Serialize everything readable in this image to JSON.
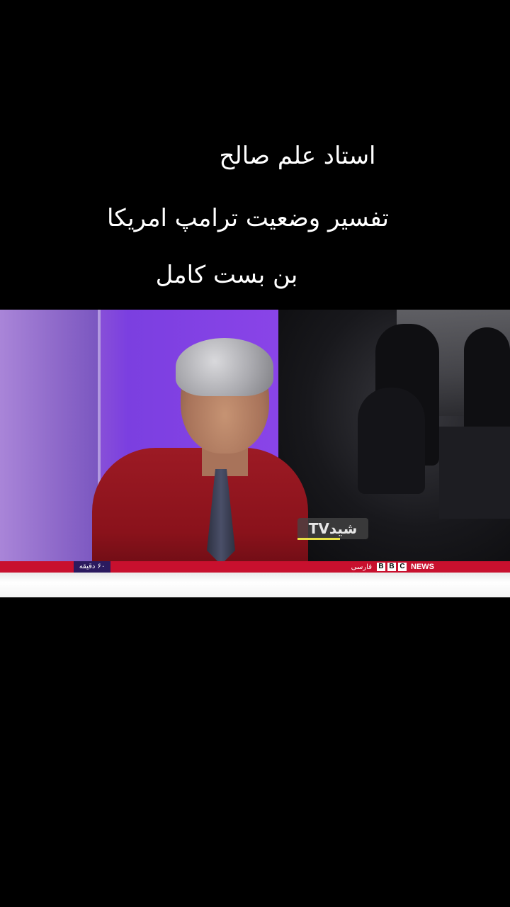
{
  "captions": {
    "line1": "استاد علم صالح",
    "line2": "تفسیر وضعیت ترامپ امریکا",
    "line3": "بن بست کامل"
  },
  "video": {
    "channel_logo_text": "شیدTV",
    "ticker": {
      "left_label": "۶۰ دقیقه",
      "brand_language": "فارسی",
      "brand_blocks": [
        "B",
        "B",
        "C"
      ],
      "brand_news": "NEWS"
    }
  },
  "colors": {
    "ticker_red": "#c8102e",
    "ticker_label_bg": "#2b1a5f",
    "logo_accent": "#e7e145",
    "studio_purple": "#8a44e8"
  }
}
